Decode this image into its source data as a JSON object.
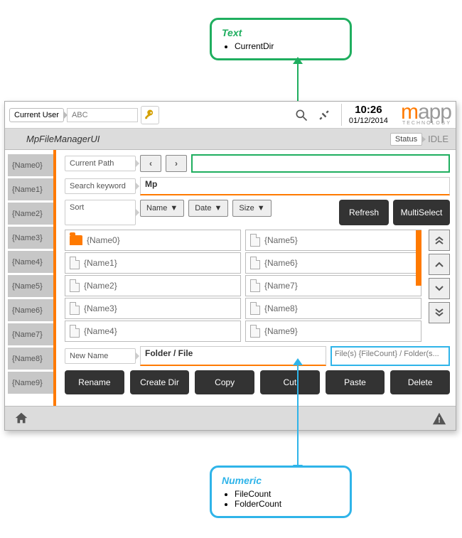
{
  "callout_green": {
    "title": "Text",
    "items": [
      "CurrentDir"
    ]
  },
  "callout_blue": {
    "title": "Numeric",
    "items": [
      "FileCount",
      "FolderCount"
    ]
  },
  "header": {
    "current_user_label": "Current User",
    "user_name": "ABC",
    "time": "10:26",
    "date": "01/12/2014",
    "logo_sub": "TECHNOLOGY"
  },
  "titlebar": {
    "title": "MpFileManagerUI",
    "status_label": "Status",
    "status_value": "IDLE"
  },
  "sidebar": {
    "items": [
      "{Name0}",
      "{Name1}",
      "{Name2}",
      "{Name3}",
      "{Name4}",
      "{Name5}",
      "{Name6}",
      "{Name7}",
      "{Name8}",
      "{Name9}"
    ]
  },
  "rows": {
    "current_path_label": "Current Path",
    "search_label": "Search keyword",
    "search_value": "Mp",
    "sort_label": "Sort",
    "sort_name": "Name",
    "sort_date": "Date",
    "sort_size": "Size",
    "refresh": "Refresh",
    "multiselect": "MultiSelect",
    "newname_label": "New Name",
    "newname_value": "Folder / File",
    "count_text": "File(s) {FileCount} / Folder(s...",
    "path_value": ""
  },
  "files": {
    "col1": [
      {
        "name": "{Name0}",
        "type": "folder"
      },
      {
        "name": "{Name1}",
        "type": "file"
      },
      {
        "name": "{Name2}",
        "type": "file"
      },
      {
        "name": "{Name3}",
        "type": "file"
      },
      {
        "name": "{Name4}",
        "type": "file"
      }
    ],
    "col2": [
      {
        "name": "{Name5}",
        "type": "file"
      },
      {
        "name": "{Name6}",
        "type": "file"
      },
      {
        "name": "{Name7}",
        "type": "file"
      },
      {
        "name": "{Name8}",
        "type": "file"
      },
      {
        "name": "{Name9}",
        "type": "file"
      }
    ]
  },
  "actions": {
    "rename": "Rename",
    "createdir": "Create Dir",
    "copy": "Copy",
    "cut": "Cut",
    "paste": "Paste",
    "delete": "Delete"
  }
}
